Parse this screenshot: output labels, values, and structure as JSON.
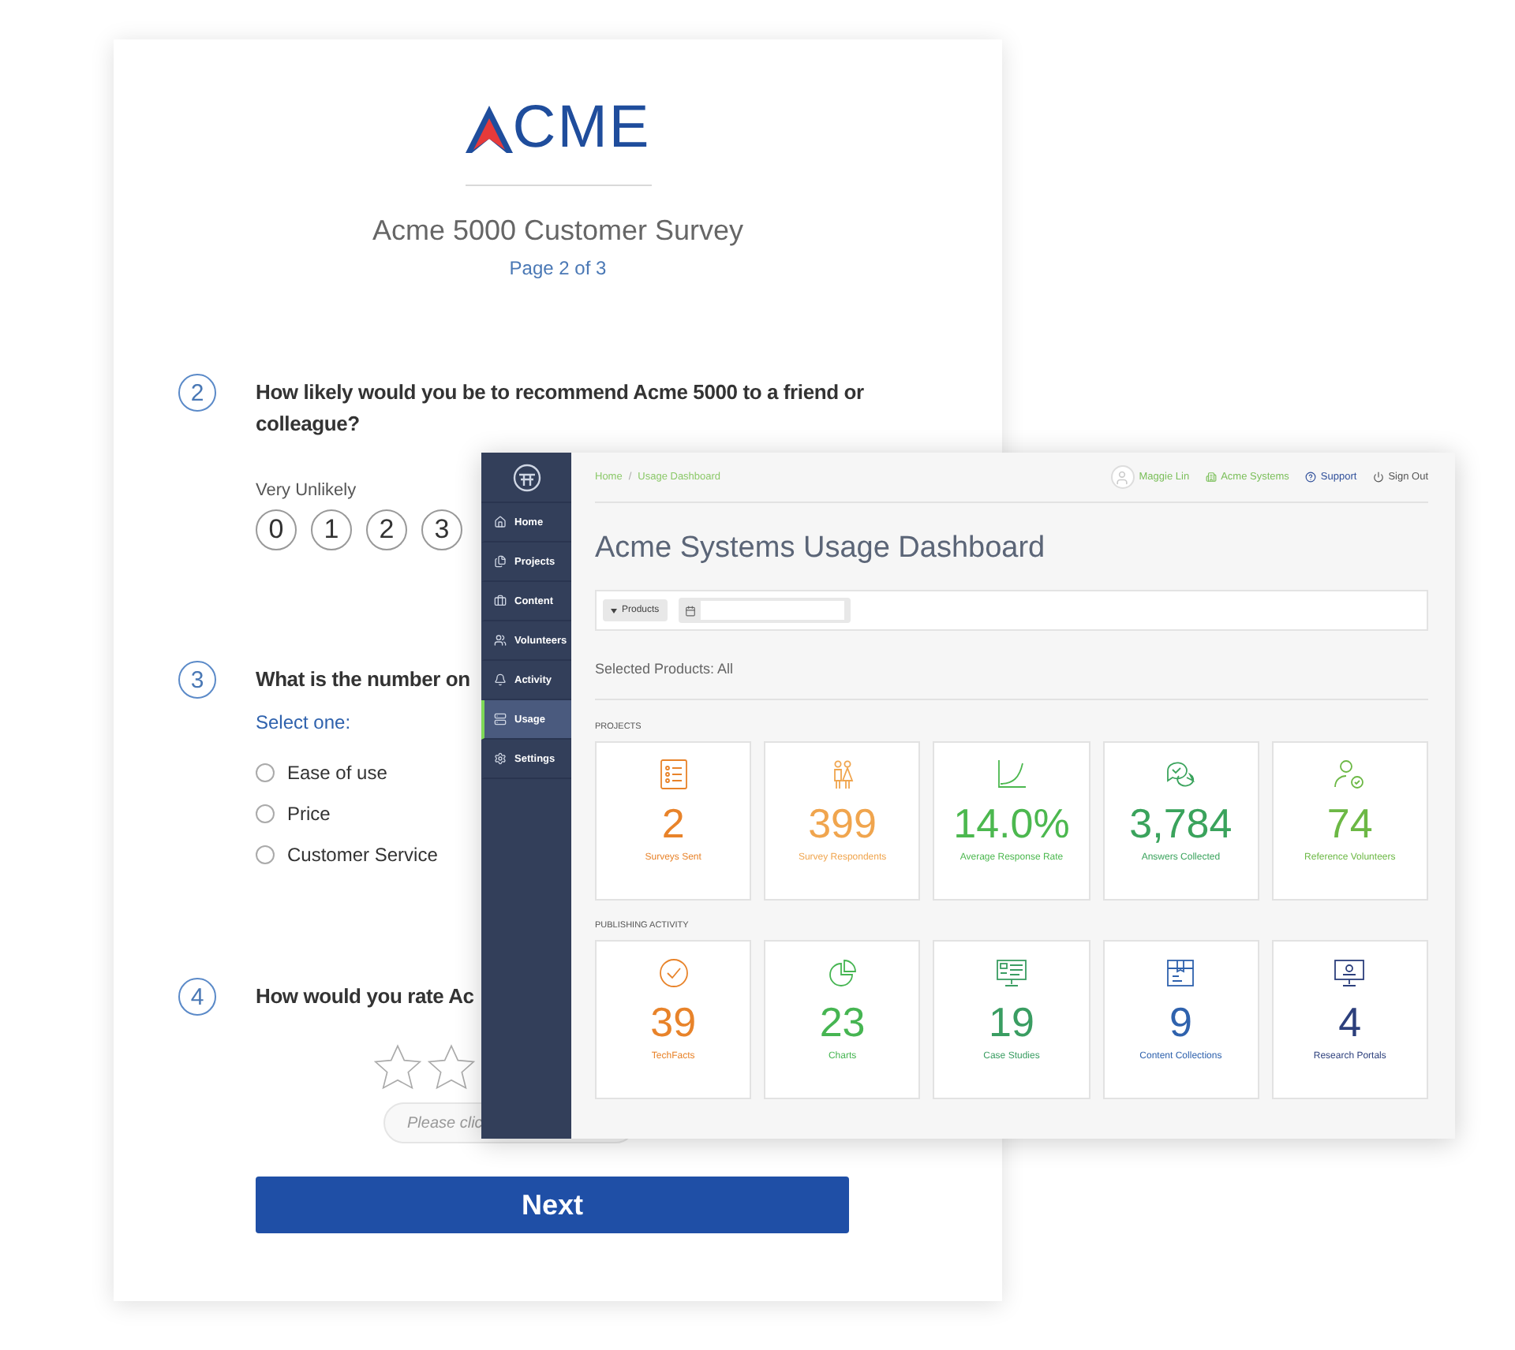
{
  "survey": {
    "logo_text": "CME",
    "title": "Acme 5000 Customer Survey",
    "page": "Page 2 of 3",
    "questions": [
      {
        "kind": "scale",
        "number": "2",
        "text": "How likely would you be to recommend Acme 5000 to a friend or colleague?",
        "scale_label": "Very Unlikely",
        "options": [
          {
            "label": "0",
            "selected": false
          },
          {
            "label": "1",
            "selected": false
          },
          {
            "label": "2",
            "selected": false
          },
          {
            "label": "3",
            "selected": false
          }
        ]
      },
      {
        "kind": "choice",
        "number": "3",
        "text": "What is the number on",
        "prompt": "Select one:",
        "options": [
          {
            "label": "Ease of use",
            "selected": false
          },
          {
            "label": "Price",
            "selected": false
          },
          {
            "label": "Customer Service",
            "selected": false
          }
        ]
      },
      {
        "kind": "rating",
        "number": "4",
        "text": "How would you rate Ac",
        "hint": "Please clic"
      }
    ],
    "next_button": "Next"
  },
  "dashboard": {
    "sidebar": [
      {
        "label": "Home",
        "selected": false
      },
      {
        "label": "Projects",
        "selected": false
      },
      {
        "label": "Content",
        "selected": false
      },
      {
        "label": "Volunteers",
        "selected": false
      },
      {
        "label": "Activity",
        "selected": false
      },
      {
        "label": "Usage",
        "selected": true
      },
      {
        "label": "Settings",
        "selected": false
      }
    ],
    "breadcrumb": [
      "Home",
      "Usage Dashboard"
    ],
    "breadcrumb_separator": "/",
    "user_menu": [
      {
        "kind": "user",
        "label": "Maggie Lin"
      },
      {
        "kind": "org",
        "label": "Acme Systems"
      },
      {
        "kind": "help",
        "label": "Support"
      },
      {
        "kind": "signout",
        "label": "Sign Out"
      }
    ],
    "title": "Acme Systems Usage Dashboard",
    "filter": {
      "dropdown": "Products"
    },
    "selected_products": "Selected Products: All",
    "sections": [
      {
        "title": "PROJECTS",
        "tiles": [
          {
            "value": "2",
            "label": "Surveys Sent",
            "color": "#e8832a"
          },
          {
            "value": "399",
            "label": "Survey Respondents",
            "color": "#f0a54e"
          },
          {
            "value": "14.0%",
            "label": "Average Response Rate",
            "color": "#4cb84f"
          },
          {
            "value": "3,784",
            "label": "Answers Collected",
            "color": "#3aa35c"
          },
          {
            "value": "74",
            "label": "Reference Volunteers",
            "color": "#6cb845"
          }
        ]
      },
      {
        "title": "PUBLISHING ACTIVITY",
        "tiles": [
          {
            "value": "39",
            "label": "TechFacts",
            "color": "#e8832a"
          },
          {
            "value": "23",
            "label": "Charts",
            "color": "#46b552"
          },
          {
            "value": "19",
            "label": "Case Studies",
            "color": "#3a9d62"
          },
          {
            "value": "9",
            "label": "Content Collections",
            "color": "#2f62ad"
          },
          {
            "value": "4",
            "label": "Research Portals",
            "color": "#2c3f7c"
          }
        ]
      }
    ]
  }
}
